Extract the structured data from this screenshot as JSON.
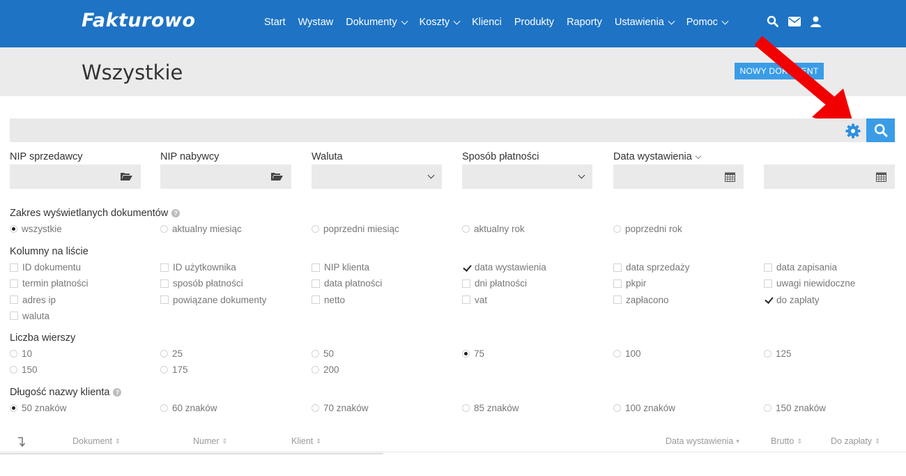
{
  "app": {
    "logo": "Fakturowo"
  },
  "nav": {
    "items": [
      {
        "label": "Start",
        "dropdown": false
      },
      {
        "label": "Wystaw",
        "dropdown": false
      },
      {
        "label": "Dokumenty",
        "dropdown": true
      },
      {
        "label": "Koszty",
        "dropdown": true
      },
      {
        "label": "Klienci",
        "dropdown": false
      },
      {
        "label": "Produkty",
        "dropdown": false
      },
      {
        "label": "Raporty",
        "dropdown": false
      },
      {
        "label": "Ustawienia",
        "dropdown": true
      },
      {
        "label": "Pomoc",
        "dropdown": true
      }
    ],
    "icons": [
      "search-icon",
      "envelope-icon",
      "user-icon"
    ]
  },
  "header": {
    "title": "Wszystkie",
    "new_document_label": "Nowy dokument"
  },
  "colors": {
    "primary": "#1e73c4",
    "button": "#3a9ce6",
    "arrow": "#f20000"
  },
  "filters": {
    "nip_seller": {
      "label": "NIP sprzedawcy",
      "value": ""
    },
    "nip_buyer": {
      "label": "NIP nabywcy",
      "value": ""
    },
    "currency": {
      "label": "Waluta",
      "value": ""
    },
    "payment_method": {
      "label": "Sposób płatności",
      "value": ""
    },
    "issue_date": {
      "label": "Data wystawienia",
      "from": "",
      "to": ""
    }
  },
  "range": {
    "title": "Zakres wyświetlanych dokumentów",
    "options": [
      {
        "label": "wszystkie",
        "selected": true
      },
      {
        "label": "aktualny miesiąc",
        "selected": false
      },
      {
        "label": "poprzedni miesiąc",
        "selected": false
      },
      {
        "label": "aktualny rok",
        "selected": false
      },
      {
        "label": "poprzedni rok",
        "selected": false
      }
    ]
  },
  "columns": {
    "title": "Kolumny na liście",
    "options": [
      {
        "label": "ID dokumentu",
        "checked": false
      },
      {
        "label": "ID użytkownika",
        "checked": false
      },
      {
        "label": "NIP klienta",
        "checked": false
      },
      {
        "label": "data wystawienia",
        "checked": true
      },
      {
        "label": "data sprzedaży",
        "checked": false
      },
      {
        "label": "data zapisania",
        "checked": false
      },
      {
        "label": "termin płatności",
        "checked": false
      },
      {
        "label": "sposób płatności",
        "checked": false
      },
      {
        "label": "data płatności",
        "checked": false
      },
      {
        "label": "dni płatności",
        "checked": false
      },
      {
        "label": "pkpir",
        "checked": false
      },
      {
        "label": "uwagi niewidoczne",
        "checked": false
      },
      {
        "label": "adres ip",
        "checked": false
      },
      {
        "label": "powiązane dokumenty",
        "checked": false
      },
      {
        "label": "netto",
        "checked": false
      },
      {
        "label": "vat",
        "checked": false
      },
      {
        "label": "zapłacono",
        "checked": false
      },
      {
        "label": "do zapłaty",
        "checked": true
      },
      {
        "label": "waluta",
        "checked": false
      }
    ]
  },
  "rows": {
    "title": "Liczba wierszy",
    "options": [
      {
        "label": "10",
        "selected": false
      },
      {
        "label": "25",
        "selected": false
      },
      {
        "label": "50",
        "selected": false
      },
      {
        "label": "75",
        "selected": true
      },
      {
        "label": "100",
        "selected": false
      },
      {
        "label": "125",
        "selected": false
      },
      {
        "label": "150",
        "selected": false
      },
      {
        "label": "175",
        "selected": false
      },
      {
        "label": "200",
        "selected": false
      }
    ]
  },
  "client_name": {
    "title": "Długość nazwy klienta",
    "options": [
      {
        "label": "50 znaków",
        "selected": true
      },
      {
        "label": "60 znaków",
        "selected": false
      },
      {
        "label": "70 znaków",
        "selected": false
      },
      {
        "label": "85 znaków",
        "selected": false
      },
      {
        "label": "100 znaków",
        "selected": false
      },
      {
        "label": "150 znaków",
        "selected": false
      }
    ]
  },
  "table": {
    "columns": [
      {
        "label": "Dokument",
        "sort": "both"
      },
      {
        "label": "Numer",
        "sort": "both"
      },
      {
        "label": "Klient",
        "sort": "both"
      },
      {
        "label": "Data wystawienia",
        "sort": "desc"
      },
      {
        "label": "Brutto",
        "sort": "both"
      },
      {
        "label": "Do zapłaty",
        "sort": "both"
      }
    ]
  }
}
